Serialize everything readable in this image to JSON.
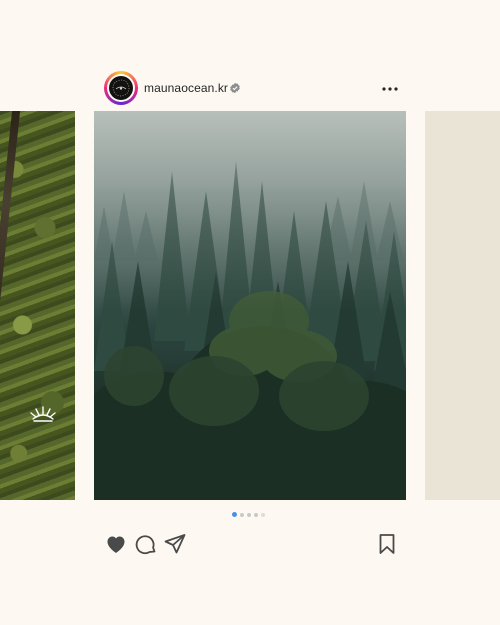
{
  "post": {
    "username": "maunaocean.kr",
    "verified": true,
    "menu_icon": "more-horizontal-icon",
    "carousel": {
      "slide_count": 5,
      "active_index": 0
    },
    "actions": {
      "like_icon": "heart-filled-icon",
      "comment_icon": "comment-icon",
      "share_icon": "send-icon",
      "save_icon": "bookmark-icon"
    }
  },
  "colors": {
    "background": "#fdf9f2",
    "text": "#262626",
    "verified": "#8e8e8e",
    "dot_active": "#4a90e2",
    "dot_inactive": "#c8c8c8",
    "right_slide": "#e9e4d6"
  }
}
